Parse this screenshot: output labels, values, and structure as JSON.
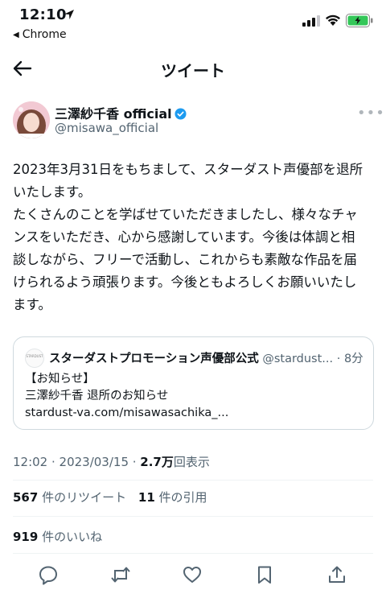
{
  "status": {
    "time": "12:10",
    "back_app": "Chrome"
  },
  "topbar": {
    "title": "ツイート"
  },
  "tweet": {
    "author_name": "三澤紗千香 official",
    "author_handle": "@misawa_official",
    "text_lines": [
      "2023年3月31日をもちまして、スターダスト声優部を退所",
      "いたします。",
      "たくさんのことを学ばせていただきましたし、様々なチャ",
      "ンスをいただき、心から感謝しています。今後は体調と相",
      "談しながら、フリーで活動し、これからも素敵な作品を届",
      "けられるよう頑張ります。今後ともよろしくお願いいたし",
      "ます。"
    ],
    "quote": {
      "logo_text": "STARDUST",
      "name": "スターダストプロモーション声優部公式",
      "handle_time": " @stardust... · 8分",
      "lines": [
        "【お知らせ】",
        "三澤紗千香 退所のお知らせ",
        "stardust-va.com/misawasachika_..."
      ]
    },
    "meta": {
      "time_date": "12:02 · 2023/03/15 · ",
      "views_count": "2.7万",
      "views_label": "回表示"
    },
    "stats": {
      "retweets_count": "567",
      "retweets_label": "件のリツイート",
      "quotes_count": "11",
      "quotes_label": "件の引用",
      "likes_count": "919",
      "likes_label": "件のいいね"
    }
  },
  "colors": {
    "verified": "#1d9bf0",
    "battery": "#34c759",
    "muted": "#536471",
    "border": "#cfd9de"
  },
  "icons": [
    "location-arrow-icon",
    "signal-icon",
    "wifi-icon",
    "battery-icon",
    "back-arrow-icon",
    "verified-icon",
    "more-icon",
    "reply-icon",
    "retweet-icon",
    "like-icon",
    "bookmark-icon",
    "share-icon"
  ]
}
